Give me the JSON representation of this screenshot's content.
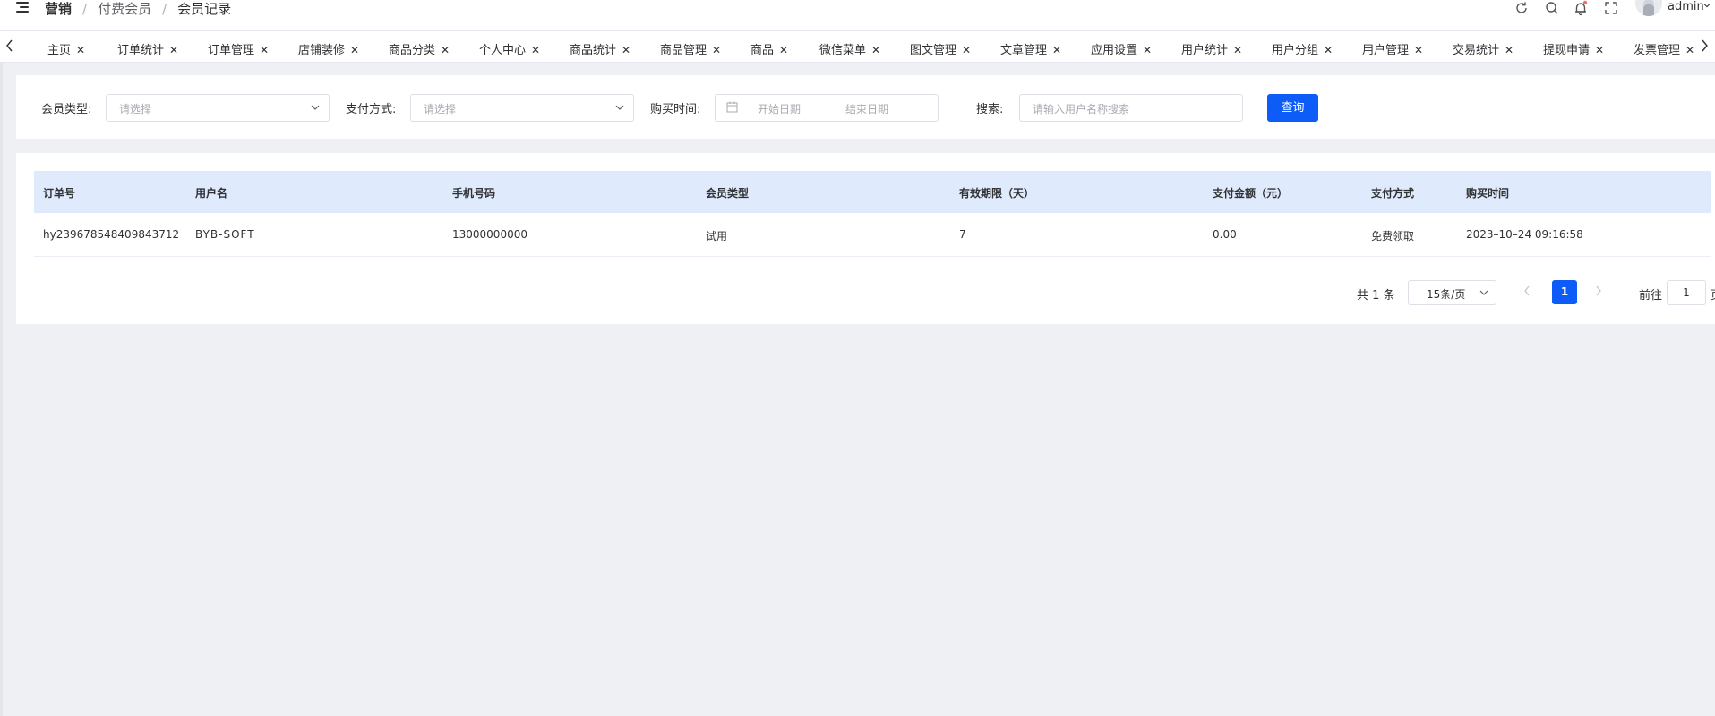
{
  "header": {
    "breadcrumb": [
      "营销",
      "付费会员",
      "会员记录"
    ],
    "user_name": "admin",
    "icons": [
      "menu-toggle-icon",
      "refresh-icon",
      "search-icon",
      "bell-icon",
      "fullscreen-icon",
      "chevron-down-icon"
    ],
    "notification_dot_color": "#f56c6c"
  },
  "tags": [
    {
      "label": "主页"
    },
    {
      "label": "订单统计"
    },
    {
      "label": "订单管理"
    },
    {
      "label": "店铺装修"
    },
    {
      "label": "商品分类"
    },
    {
      "label": "个人中心"
    },
    {
      "label": "商品统计"
    },
    {
      "label": "商品管理"
    },
    {
      "label": "商品"
    },
    {
      "label": "微信菜单"
    },
    {
      "label": "图文管理"
    },
    {
      "label": "文章管理"
    },
    {
      "label": "应用设置"
    },
    {
      "label": "用户统计"
    },
    {
      "label": "用户分组"
    },
    {
      "label": "用户管理"
    },
    {
      "label": "交易统计"
    },
    {
      "label": "提现申请"
    },
    {
      "label": "发票管理"
    }
  ],
  "filters": {
    "member_type_label": "会员类型:",
    "member_type_placeholder": "请选择",
    "pay_method_label": "支付方式:",
    "pay_method_placeholder": "请选择",
    "purchase_time_label": "购买时间:",
    "start_placeholder": "开始日期",
    "range_sep": "–",
    "end_placeholder": "结束日期",
    "search_label": "搜索:",
    "search_placeholder": "请输入用户名称搜索",
    "query_button": "查询"
  },
  "table": {
    "columns": [
      "订单号",
      "用户名",
      "手机号码",
      "会员类型",
      "有效期限（天）",
      "支付金额（元）",
      "支付方式",
      "购买时间"
    ],
    "rows": [
      [
        "hy239678548409843712",
        "BYB-SOFT",
        "13000000000",
        "试用",
        "7",
        "0.00",
        "免费领取",
        "2023–10–24 09:16:58"
      ]
    ]
  },
  "pagination": {
    "total_text": "共 1 条",
    "page_size": "15条/页",
    "current_page": "1",
    "goto_label": "前往",
    "goto_value": "1",
    "goto_suffix": "页"
  },
  "colors": {
    "primary": "#0e5cf7",
    "table_header_bg": "#dfeafd",
    "page_bg": "#eef0f4"
  }
}
